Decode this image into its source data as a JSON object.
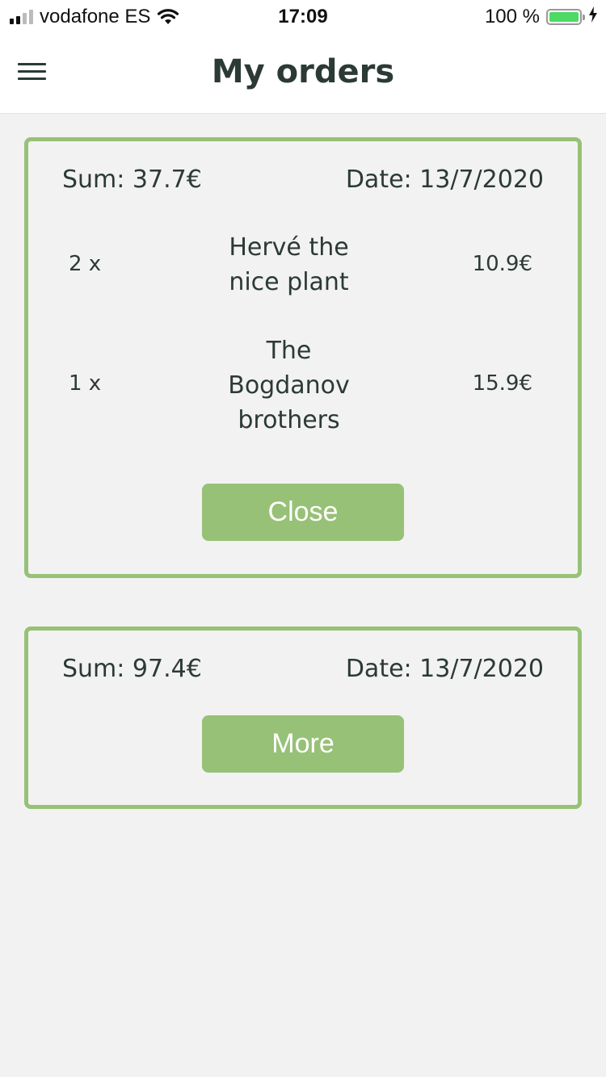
{
  "status_bar": {
    "carrier": "vodafone ES",
    "time": "17:09",
    "battery": "100 %",
    "icons": [
      "signal-icon",
      "wifi-icon",
      "battery-icon",
      "charging-icon"
    ]
  },
  "header": {
    "title": "My orders",
    "menu_icon": "hamburger-menu-icon"
  },
  "orders": [
    {
      "sum": "Sum: 37.7€",
      "date": "Date: 13/7/2020",
      "items": [
        {
          "quantity": "2 x",
          "name": "Hervé the nice plant",
          "price": "10.9€"
        },
        {
          "quantity": "1 x",
          "name": "The Bogdanov brothers",
          "price": "15.9€"
        }
      ],
      "button_label": "Close"
    },
    {
      "sum": "Sum: 97.4€",
      "date": "Date: 13/7/2020",
      "button_label": "More"
    }
  ],
  "colors": {
    "accent": "#97c177",
    "text": "#2c3a35",
    "background": "#f2f2f2",
    "battery": "#4cd964"
  }
}
